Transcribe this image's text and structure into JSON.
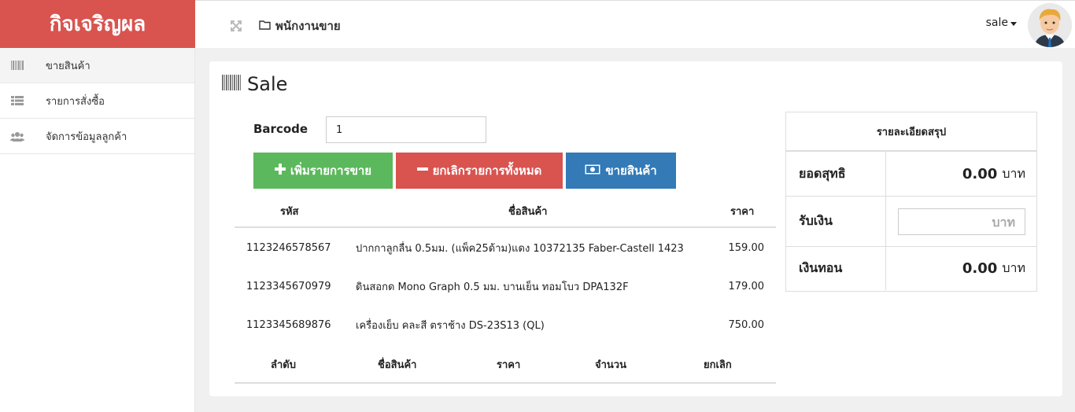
{
  "brand": {
    "name": "กิจเจริญผล",
    "color": "#d9534f"
  },
  "topbar": {
    "breadcrumb": "พนักงานขาย",
    "user_name": "sale"
  },
  "sidebar": {
    "items": [
      {
        "label": "ขายสินค้า",
        "icon": "barcode-icon",
        "active": true
      },
      {
        "label": "รายการสั่งซื้อ",
        "icon": "list-icon",
        "active": false
      },
      {
        "label": "จัดการข้อมูลลูกค้า",
        "icon": "users-icon",
        "active": false
      }
    ]
  },
  "sale": {
    "title": "Sale",
    "barcode_label": "Barcode",
    "barcode_value": "1",
    "buttons": {
      "add": "เพิ่มรายการขาย",
      "cancel_all": "ยกเลิกรายการทั้งหมด",
      "sell": "ขายสินค้า"
    },
    "colors": {
      "add": "#5cb85c",
      "cancel": "#d9534f",
      "sell": "#337ab7"
    },
    "table": {
      "headers": {
        "code": "รหัส",
        "name": "ชื่อสินค้า",
        "price": "ราคา"
      },
      "rows": [
        {
          "code": "1123246578567",
          "name": "ปากกาลูกลื่น 0.5มม. (แพ็ค25ด้าม)แดง 10372135 Faber-Castell 1423",
          "price": "159.00"
        },
        {
          "code": "1123345670979",
          "name": "ดินสอกด Mono Graph 0.5 มม. บานเย็น ทอมโบว DPA132F",
          "price": "179.00"
        },
        {
          "code": "1123345689876",
          "name": "เครื่องเย็บ คละสี ตราช้าง DS-23S13 (QL)",
          "price": "750.00"
        }
      ]
    },
    "cart_headers": {
      "order": "ลำดับ",
      "name": "ชื่อสินค้า",
      "price": "ราคา",
      "qty": "จำนวน",
      "cancel": "ยกเลิก"
    }
  },
  "summary": {
    "title": "รายละเอียดสรุป",
    "net_label": "ยอดสุทธิ",
    "net_value": "0.00",
    "received_label": "รับเงิน",
    "received_placeholder": "บาท",
    "change_label": "เงินทอน",
    "change_value": "0.00",
    "unit": "บาท"
  }
}
